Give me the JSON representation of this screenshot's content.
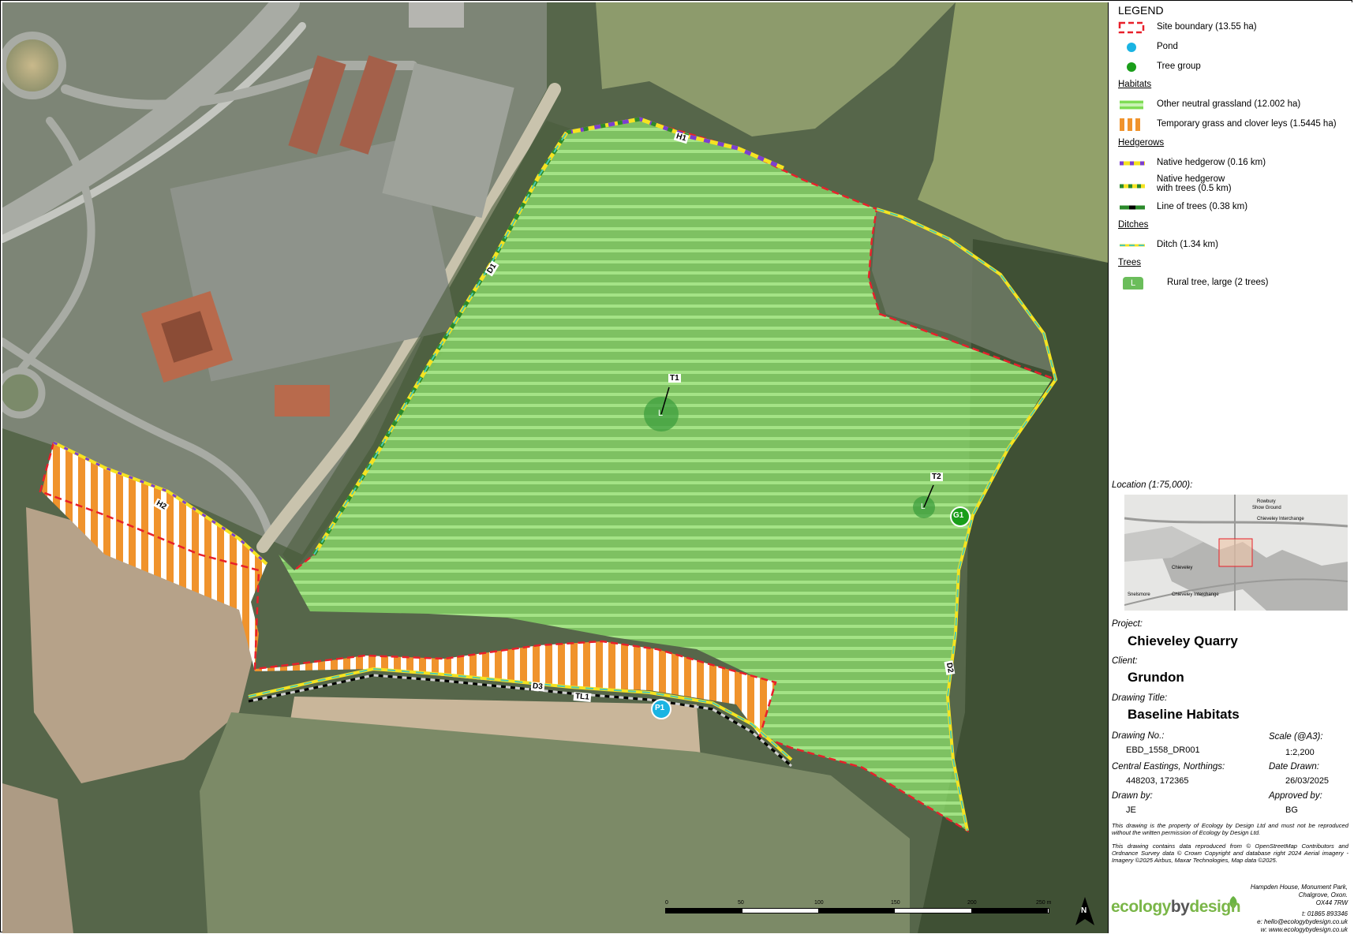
{
  "legend": {
    "title": "LEGEND",
    "items": [
      {
        "id": "site-boundary",
        "label": "Site boundary (13.55 ha)"
      },
      {
        "id": "pond",
        "label": "Pond"
      },
      {
        "id": "tree-group",
        "label": "Tree group"
      }
    ],
    "habitats_heading": "Habitats",
    "habitats": [
      {
        "label": "Other neutral grassland (12.002 ha)"
      },
      {
        "label": "Temporary grass and clover leys (1.5445 ha)"
      }
    ],
    "hedgerows_heading": "Hedgerows",
    "hedgerows": [
      {
        "label": "Native hedgerow (0.16 km)"
      },
      {
        "label_line1": "Native hedgerow",
        "label_line2": "with trees (0.5 km)"
      },
      {
        "label": "Line of trees (0.38 km)"
      }
    ],
    "ditches_heading": "Ditches",
    "ditches": [
      {
        "label": "Ditch (1.34 km)"
      }
    ],
    "trees_heading": "Trees",
    "trees": [
      {
        "label": "Rural tree, large (2 trees)",
        "symbol_letter": "L"
      }
    ]
  },
  "location": {
    "label": "Location (1:75,000):",
    "place_labels": [
      "Rowbury",
      "Show Ground",
      "Chieveley Interchange",
      "Chieveley",
      "Chieveley Interchange",
      "Snelsmore"
    ]
  },
  "project": {
    "label": "Project:",
    "value": "Chieveley Quarry"
  },
  "client": {
    "label": "Client:",
    "value": "Grundon"
  },
  "drawing_title": {
    "label": "Drawing Title:",
    "value": "Baseline Habitats"
  },
  "drawing_no": {
    "label": "Drawing No.:",
    "value": "EBD_1558_DR001"
  },
  "scale": {
    "label": "Scale (@A3):",
    "value": "1:2,200"
  },
  "eastings": {
    "label": "Central Eastings, Northings:",
    "value": "448203, 172365"
  },
  "date_drawn": {
    "label": "Date Drawn:",
    "value": "26/03/2025"
  },
  "drawn_by": {
    "label": "Drawn by:",
    "value": "JE"
  },
  "approved_by": {
    "label": "Approved by:",
    "value": "BG"
  },
  "notes": {
    "property": "This drawing is the property of Ecology by Design Ltd and must not be reproduced without the written permission of Ecology by Design Ltd.",
    "data": "This drawing contains data reproduced from © OpenStreetMap Contributors and Ordnance Survey data © Crown Copyright and database right 2024 Aerial imagery - Imagery ©2025 Airbus, Maxar Technologies, Map data ©2025."
  },
  "address": {
    "line1": "Hampden House, Monument Park,",
    "line2": "Chalgrove, Oxon.",
    "line3": "OX44 7RW",
    "tel": "t: 01865 893346",
    "email": "e: hello@ecologybydesign.co.uk",
    "web": "w: www.ecologybydesign.co.uk"
  },
  "logo": {
    "part1": "ecology",
    "part2": "by",
    "part3": "design"
  },
  "scalebar": {
    "ticks": [
      "0",
      "50",
      "100",
      "150",
      "200",
      "250 m"
    ]
  },
  "north": "N",
  "map_labels": {
    "H1": "H1",
    "H2": "H2",
    "D1": "D1",
    "D2": "D2",
    "D3": "D3",
    "TL1": "TL1",
    "T1": "T1",
    "T2": "T2",
    "G1": "G1",
    "P1": "P1",
    "tree_letter": "L"
  },
  "colors": {
    "boundary": "#e8202a",
    "pond": "#1ab4e3",
    "tree_group": "#1a9e1a",
    "grassland": "#8ee56b",
    "leys": "#f0932c",
    "hedge_yellow": "#f5e321",
    "hedge_purple": "#7b3fd1",
    "trees_green": "#2b8a2b",
    "ditch": "#4ec9b0"
  }
}
